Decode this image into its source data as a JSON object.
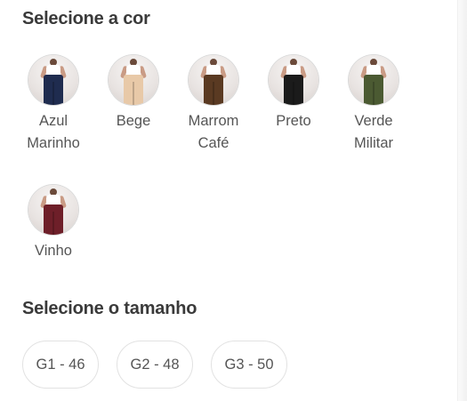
{
  "color_section": {
    "title": "Selecione a cor",
    "options": [
      {
        "line1": "Azul",
        "line2": "Marinho",
        "pants_color": "#1f2c4f"
      },
      {
        "line1": "Bege",
        "line2": "",
        "pants_color": "#e8c9a8"
      },
      {
        "line1": "Marrom",
        "line2": "Café",
        "pants_color": "#5a3a22"
      },
      {
        "line1": "Preto",
        "line2": "",
        "pants_color": "#1b1b1b"
      },
      {
        "line1": "Verde",
        "line2": "Militar",
        "pants_color": "#4b5a32"
      },
      {
        "line1": "Vinho",
        "line2": "",
        "pants_color": "#6e1f29"
      }
    ]
  },
  "size_section": {
    "title": "Selecione o tamanho",
    "options": [
      "G1 - 46",
      "G2 - 48",
      "G3 - 50"
    ]
  }
}
